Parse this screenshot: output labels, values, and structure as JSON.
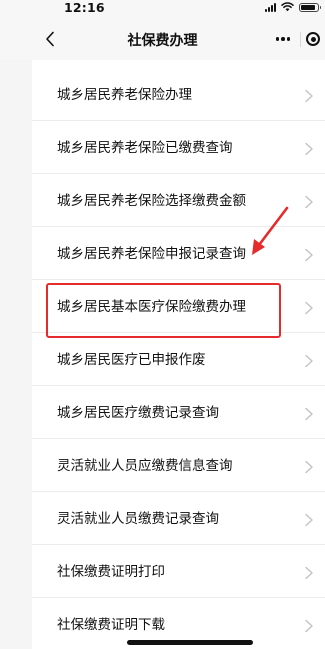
{
  "status_bar": {
    "time": "12:16"
  },
  "nav": {
    "title": "社保费办理",
    "back_icon": "chevron-left-icon",
    "more_icon": "more-dots-icon",
    "close_icon": "target-icon"
  },
  "menu": {
    "items": [
      {
        "label": "城乡居民养老保险办理"
      },
      {
        "label": "城乡居民养老保险已缴费查询"
      },
      {
        "label": "城乡居民养老保险选择缴费金额"
      },
      {
        "label": "城乡居民养老保险申报记录查询"
      },
      {
        "label": "城乡居民基本医疗保险缴费办理"
      },
      {
        "label": "城乡居民医疗已申报作废"
      },
      {
        "label": "城乡居民医疗缴费记录查询"
      },
      {
        "label": "灵活就业人员应缴费信息查询"
      },
      {
        "label": "灵活就业人员缴费记录查询"
      },
      {
        "label": "社保缴费证明打印"
      },
      {
        "label": "社保缴费证明下载"
      }
    ],
    "chevron_icon": "chevron-right-icon"
  },
  "annotation": {
    "highlight_color": "#e52b2b",
    "highlighted_item": "城乡居民基本医疗保险缴费办理"
  }
}
